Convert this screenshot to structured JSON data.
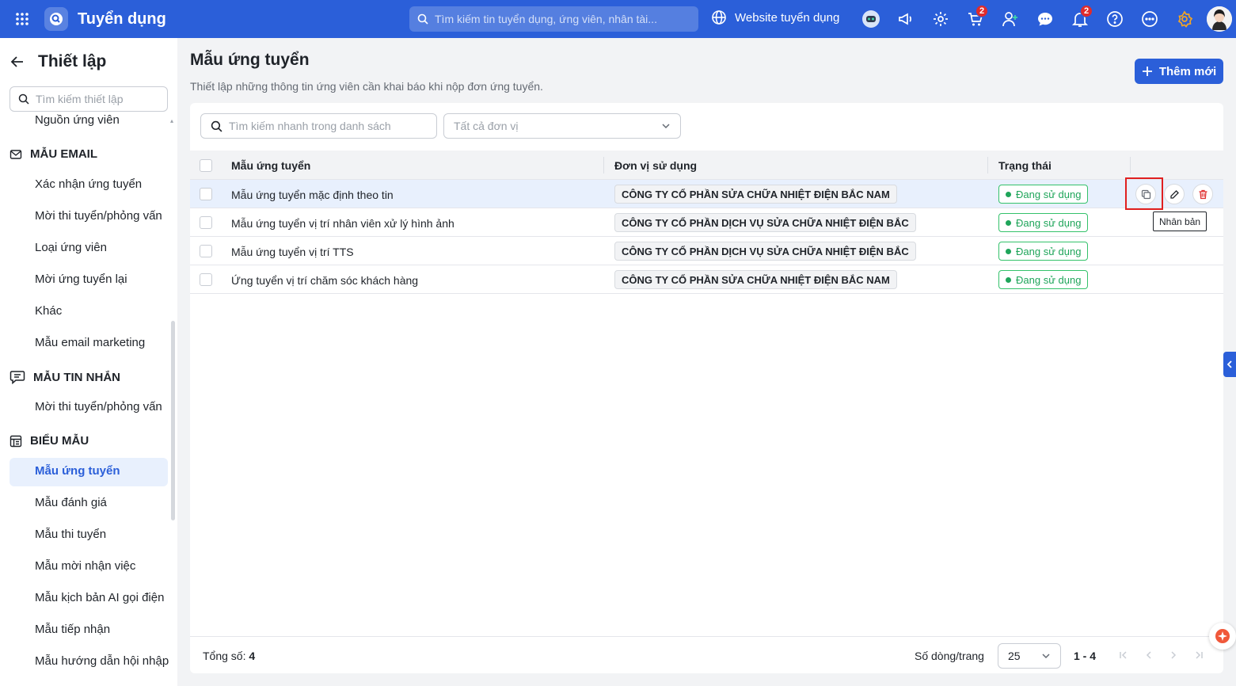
{
  "topbar": {
    "app_title": "Tuyển dụng",
    "search_placeholder": "Tìm kiếm tin tuyển dụng, ứng viên, nhân tài...",
    "website_label": "Website tuyển dụng",
    "icons": [
      "grid-icon",
      "ai-bot-icon",
      "megaphone-icon",
      "gear-icon",
      "cart-icon",
      "add-user-icon",
      "chat-icon",
      "bell-icon",
      "help-icon",
      "more-icon",
      "award-icon"
    ],
    "cart_badge": "2",
    "bell_badge": "2"
  },
  "sidebar": {
    "title": "Thiết lập",
    "search_placeholder": "Tìm kiếm thiết lập",
    "top_item": "Nguồn ứng viên",
    "sections": [
      {
        "title": "MẪU EMAIL",
        "items": [
          "Xác nhận ứng tuyển",
          "Mời thi tuyển/phỏng vấn",
          "Loại ứng viên",
          "Mời ứng tuyển lại",
          "Khác",
          "Mẫu email marketing"
        ]
      },
      {
        "title": "MẪU TIN NHẮN",
        "items": [
          "Mời thi tuyển/phỏng vấn"
        ]
      },
      {
        "title": "BIỂU MẪU",
        "items": [
          "Mẫu ứng tuyển",
          "Mẫu đánh giá",
          "Mẫu thi tuyển",
          "Mẫu mời nhận việc",
          "Mẫu kịch bản AI gọi điện",
          "Mẫu tiếp nhận",
          "Mẫu hướng dẫn hội nhập"
        ]
      }
    ],
    "active_item": "Mẫu ứng tuyển"
  },
  "main": {
    "title": "Mẫu ứng tuyển",
    "description": "Thiết lập những thông tin ứng viên cần khai báo khi nộp đơn ứng tuyển.",
    "add_button": "Thêm mới",
    "filter_search_placeholder": "Tìm kiếm nhanh trong danh sách",
    "filter_unit": "Tất cả đơn vị",
    "columns": [
      "Mẫu ứng tuyển",
      "Đơn vị sử dụng",
      "Trạng thái"
    ],
    "rows": [
      {
        "name": "Mẫu ứng tuyển mặc định theo tin",
        "unit": "CÔNG TY CỔ PHẦN SỬA CHỮA NHIỆT ĐIỆN BẮC NAM",
        "status": "Đang sử dụng"
      },
      {
        "name": "Mẫu ứng tuyển vị trí nhân viên xử lý hình ảnh",
        "unit": "CÔNG TY CỔ PHẦN DỊCH VỤ SỬA CHỮA NHIỆT ĐIỆN BẮC",
        "status": "Đang sử dụng"
      },
      {
        "name": "Mẫu ứng tuyển vị trí TTS",
        "unit": "CÔNG TY CỔ PHẦN DỊCH VỤ SỬA CHỮA NHIỆT ĐIỆN BẮC",
        "status": "Đang sử dụng"
      },
      {
        "name": "Ứng tuyển vị trí chăm sóc khách hàng",
        "unit": "CÔNG TY CỔ PHẦN SỬA CHỮA NHIỆT ĐIỆN BẮC NAM",
        "status": "Đang sử dụng"
      }
    ],
    "tooltip": "Nhân bản",
    "footer": {
      "total_label": "Tổng số:",
      "total_value": "4",
      "per_page_label": "Số dòng/trang",
      "per_page_value": "25",
      "range": "1 - 4"
    }
  },
  "colors": {
    "primary": "#2b5fd9",
    "status_green": "#1fa55a",
    "highlight_red": "#e02020",
    "delete_red": "#e03131"
  }
}
